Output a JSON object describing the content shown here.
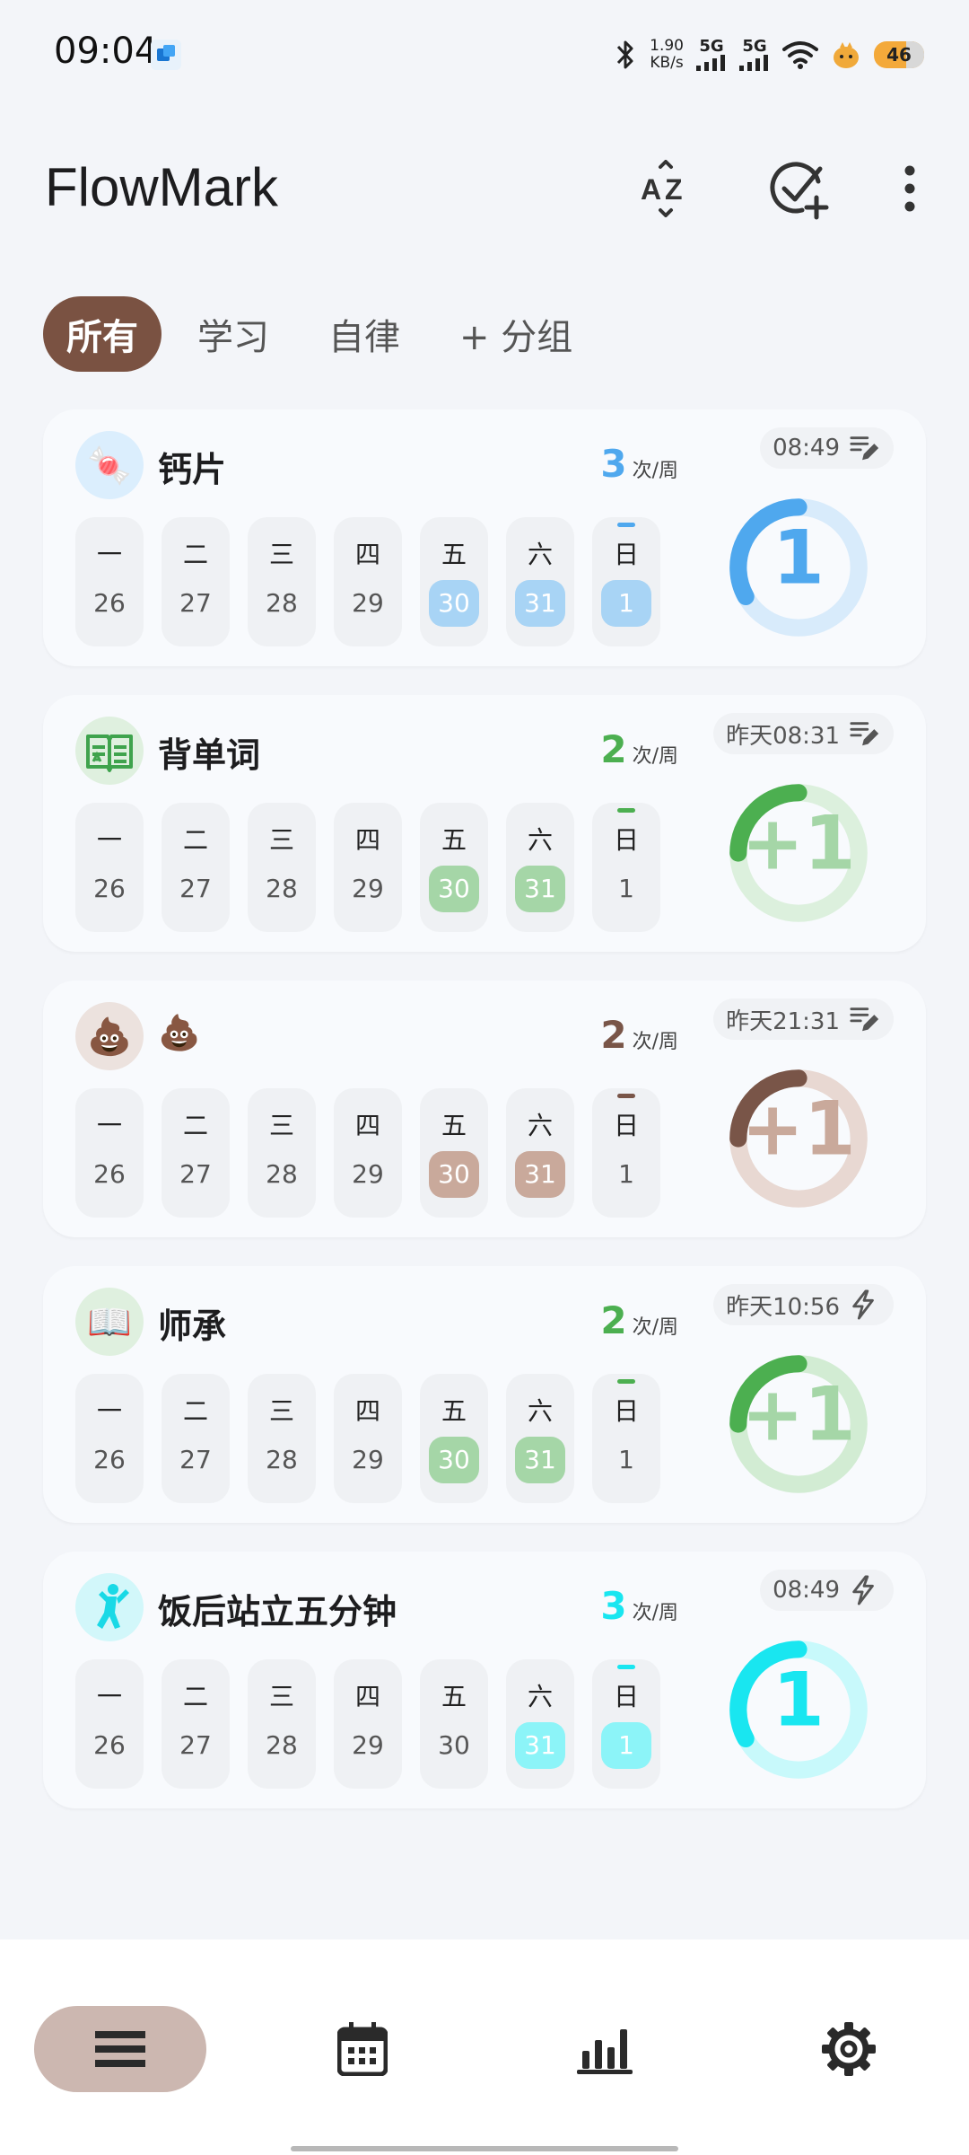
{
  "status_bar": {
    "time": "09:04",
    "net_speed_value": "1.90",
    "net_speed_unit": "KB/s",
    "signal1": "5G",
    "signal2": "5G",
    "battery": "46"
  },
  "app": {
    "title": "FlowMark"
  },
  "header_icons": [
    "sort-az-icon",
    "add-habit-icon",
    "more-vert-icon"
  ],
  "tabs": [
    {
      "label": "所有",
      "active": true
    },
    {
      "label": "学习",
      "active": false
    },
    {
      "label": "自律",
      "active": false
    },
    {
      "label": "+ 分组",
      "active": false
    }
  ],
  "weekdays": [
    "一",
    "二",
    "三",
    "四",
    "五",
    "六",
    "日"
  ],
  "dates": [
    "26",
    "27",
    "28",
    "29",
    "30",
    "31",
    "1"
  ],
  "habits": [
    {
      "name": "钙片",
      "icon": "candy-icon",
      "emoji": "🍬",
      "freq": "3",
      "freq_unit": "次/周",
      "color": "#4fa8ee",
      "light": "#a8d4f5",
      "ring_bg": "#d8ebfb",
      "icon_bg": "#dbeefd",
      "time": "08:49",
      "meta_icon": "notes-icon",
      "ring_text": "1",
      "progress": 0.33,
      "done": [
        false,
        false,
        false,
        false,
        true,
        true,
        true
      ]
    },
    {
      "name": "背单词",
      "icon": "book-icon",
      "emoji": "",
      "freq": "2",
      "freq_unit": "次/周",
      "color": "#4caf50",
      "light": "#a5d6a7",
      "ring_bg": "#dcf0dd",
      "icon_bg": "#dff0df",
      "time": "昨天08:31",
      "meta_icon": "notes-icon",
      "ring_text": "+1",
      "progress": 0.25,
      "done": [
        false,
        false,
        false,
        false,
        true,
        true,
        false
      ]
    },
    {
      "name": "💩",
      "icon": "poop-icon",
      "emoji": "💩",
      "freq": "2",
      "freq_unit": "次/周",
      "color": "#795548",
      "light": "#c9a99b",
      "ring_bg": "#e8d8d2",
      "icon_bg": "#ece2de",
      "time": "昨天21:31",
      "meta_icon": "notes-icon",
      "ring_text": "+1",
      "progress": 0.25,
      "done": [
        false,
        false,
        false,
        false,
        true,
        true,
        false
      ]
    },
    {
      "name": "师承",
      "icon": "open-book-icon",
      "emoji": "📖",
      "freq": "2",
      "freq_unit": "次/周",
      "color": "#4caf50",
      "light": "#a5d6a7",
      "ring_bg": "#d2ecd3",
      "icon_bg": "#dff0df",
      "time": "昨天10:56",
      "meta_icon": "lightning-icon",
      "ring_text": "+1",
      "progress": 0.25,
      "done": [
        false,
        false,
        false,
        false,
        true,
        true,
        false
      ]
    },
    {
      "name": "饭后站立五分钟",
      "icon": "person-standing-icon",
      "emoji": "",
      "freq": "3",
      "freq_unit": "次/周",
      "color": "#19e6f0",
      "light": "#8cf4f8",
      "ring_bg": "#c8f9fb",
      "icon_bg": "#d2f7fa",
      "time": "08:49",
      "meta_icon": "lightning-icon",
      "ring_text": "1",
      "progress": 0.33,
      "done": [
        false,
        false,
        false,
        false,
        false,
        true,
        true
      ]
    }
  ],
  "bottom_nav": [
    {
      "name": "list-icon",
      "active": true
    },
    {
      "name": "calendar-icon",
      "active": false
    },
    {
      "name": "chart-icon",
      "active": false
    },
    {
      "name": "settings-icon",
      "active": false
    }
  ]
}
